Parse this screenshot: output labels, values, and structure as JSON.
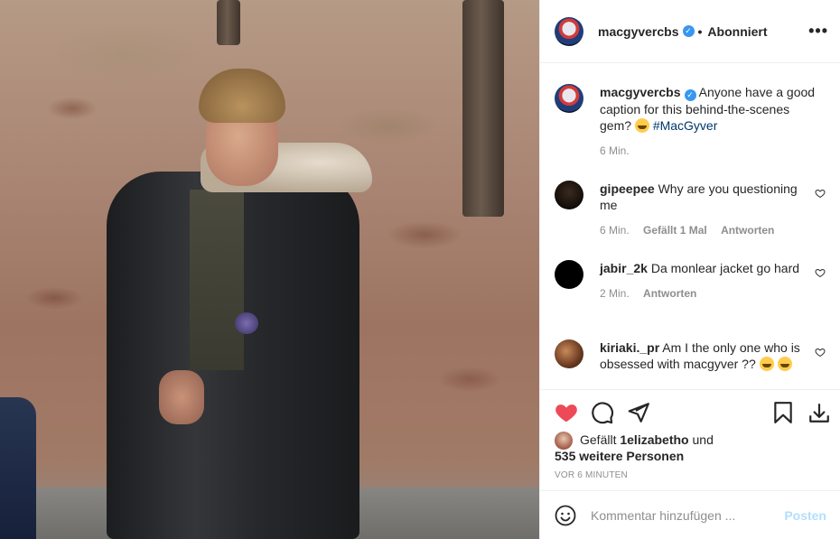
{
  "post": {
    "author": "macgyvercbs",
    "follow_separator": "•",
    "follow_status": "Abonniert",
    "more_label": "•••"
  },
  "caption": {
    "username": "macgyvercbs",
    "text": "Anyone have a good caption for this behind-the-scenes gem?",
    "hashtag": "#MacGyver",
    "time": "6 Min."
  },
  "comments": [
    {
      "username": "gipeepee",
      "text": "Why are you questioning me",
      "time": "6 Min.",
      "likes": "Gefällt 1 Mal",
      "reply": "Antworten"
    },
    {
      "username": "jabir_2k",
      "text": "Da monlear jacket go hard",
      "time": "2 Min.",
      "reply": "Antworten"
    },
    {
      "username": "kiriaki._pr",
      "text": "Am I the only one who is obsessed with macgyver ??"
    }
  ],
  "likes": {
    "prefix": "Gefällt",
    "first_user": "1elizabetho",
    "joiner": "und",
    "others": "535 weitere Personen"
  },
  "timestamp": "VOR 6 MINUTEN",
  "composer": {
    "placeholder": "Kommentar hinzufügen ...",
    "post_label": "Posten"
  },
  "colors": {
    "like_red": "#ed4956",
    "link_blue": "#00376b",
    "verified_blue": "#3897f0",
    "post_disabled": "#b2dffc"
  },
  "icons": [
    "heart-filled-icon",
    "comment-icon",
    "share-icon",
    "bookmark-icon",
    "download-icon",
    "smile-icon",
    "verified-icon",
    "more-icon"
  ]
}
